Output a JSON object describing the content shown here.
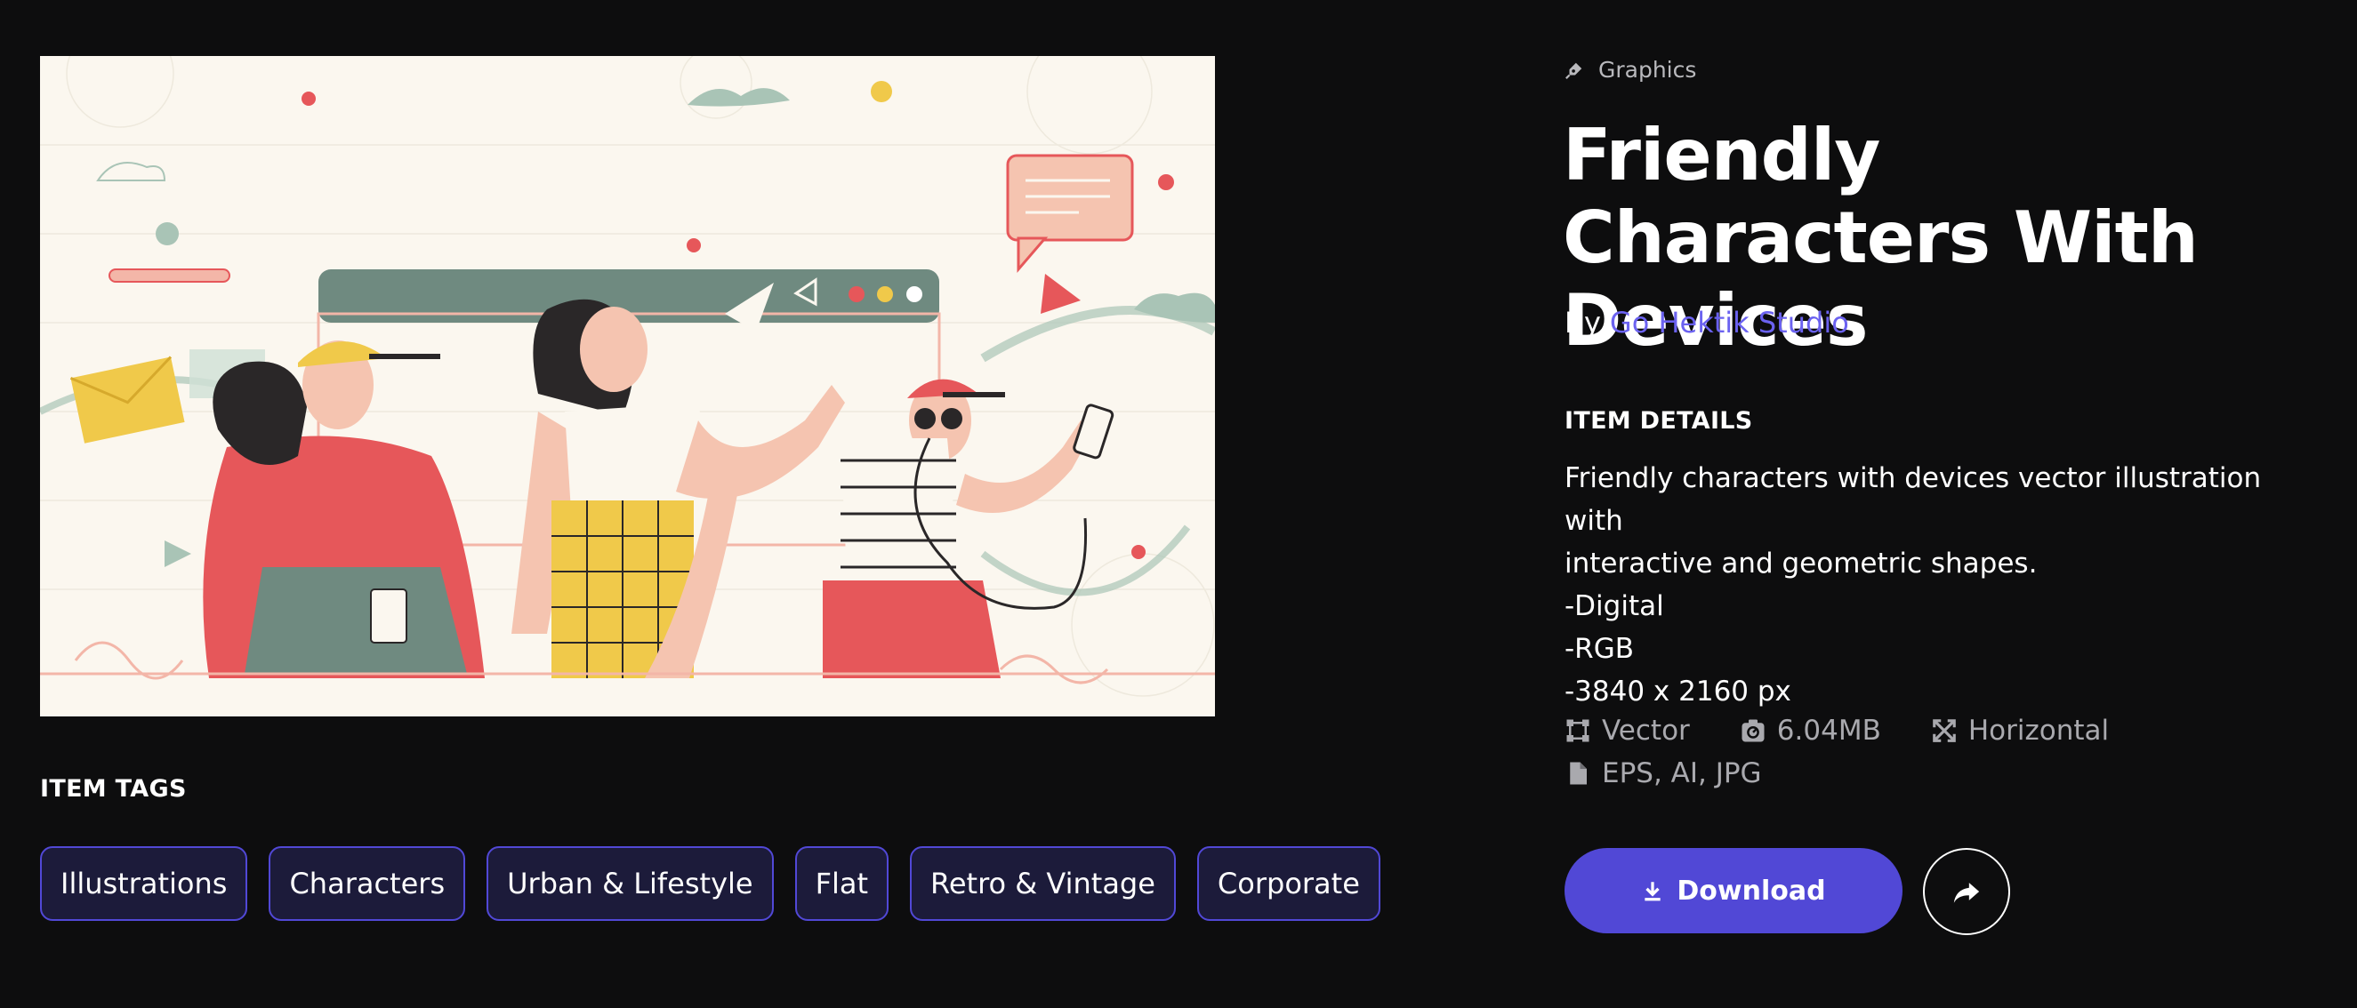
{
  "preview": {
    "alt": "Friendly characters with devices illustration"
  },
  "tags": {
    "heading": "ITEM TAGS",
    "items": [
      "Illustrations",
      "Characters",
      "Urban & Lifestyle",
      "Flat",
      "Retro & Vintage",
      "Corporate"
    ]
  },
  "item": {
    "category": "Graphics",
    "category_icon": "pen-nib-icon",
    "title": "Friendly Characters With Devices",
    "by_label": "By",
    "author": "Go Hektik Studio",
    "details_heading": "ITEM DETAILS",
    "description": [
      "Friendly characters with devices vector illustration with",
      "interactive and geometric shapes.",
      "-Digital",
      "-RGB",
      "-3840 x 2160 px"
    ],
    "meta": {
      "format": "Vector",
      "size": "6.04MB",
      "orientation": "Horizontal",
      "files": "EPS, AI, JPG"
    }
  },
  "actions": {
    "download_label": "Download",
    "share_icon": "share-arrow-icon"
  },
  "colors": {
    "background": "#0d0d0e",
    "accent": "#5148d6",
    "author_link": "#6b62f0",
    "tag_bg": "#1c1b3a",
    "preview_bg": "#fbf7ef"
  }
}
